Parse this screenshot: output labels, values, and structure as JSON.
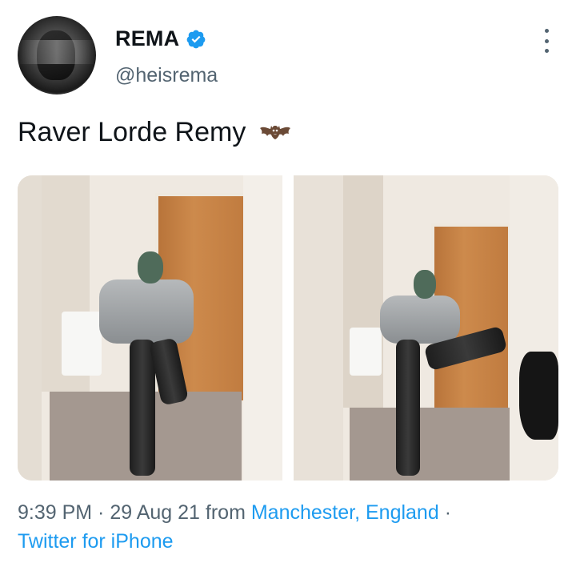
{
  "author": {
    "name": "REMA",
    "handle": "@heisrema",
    "verified": true,
    "verified_color": "#1d9bf0"
  },
  "tweet": {
    "text": "Raver Lorde Remy",
    "emoji": "bat-emoji"
  },
  "media": {
    "count": 2
  },
  "meta": {
    "time": "9:39 PM",
    "separator": " · ",
    "date": "29 Aug 21",
    "from_text": " from ",
    "location": "Manchester, England",
    "trailing_separator": " ·",
    "source": "Twitter for iPhone"
  },
  "colors": {
    "text": "#0f1419",
    "secondary": "#536471",
    "link": "#1d9bf0"
  }
}
